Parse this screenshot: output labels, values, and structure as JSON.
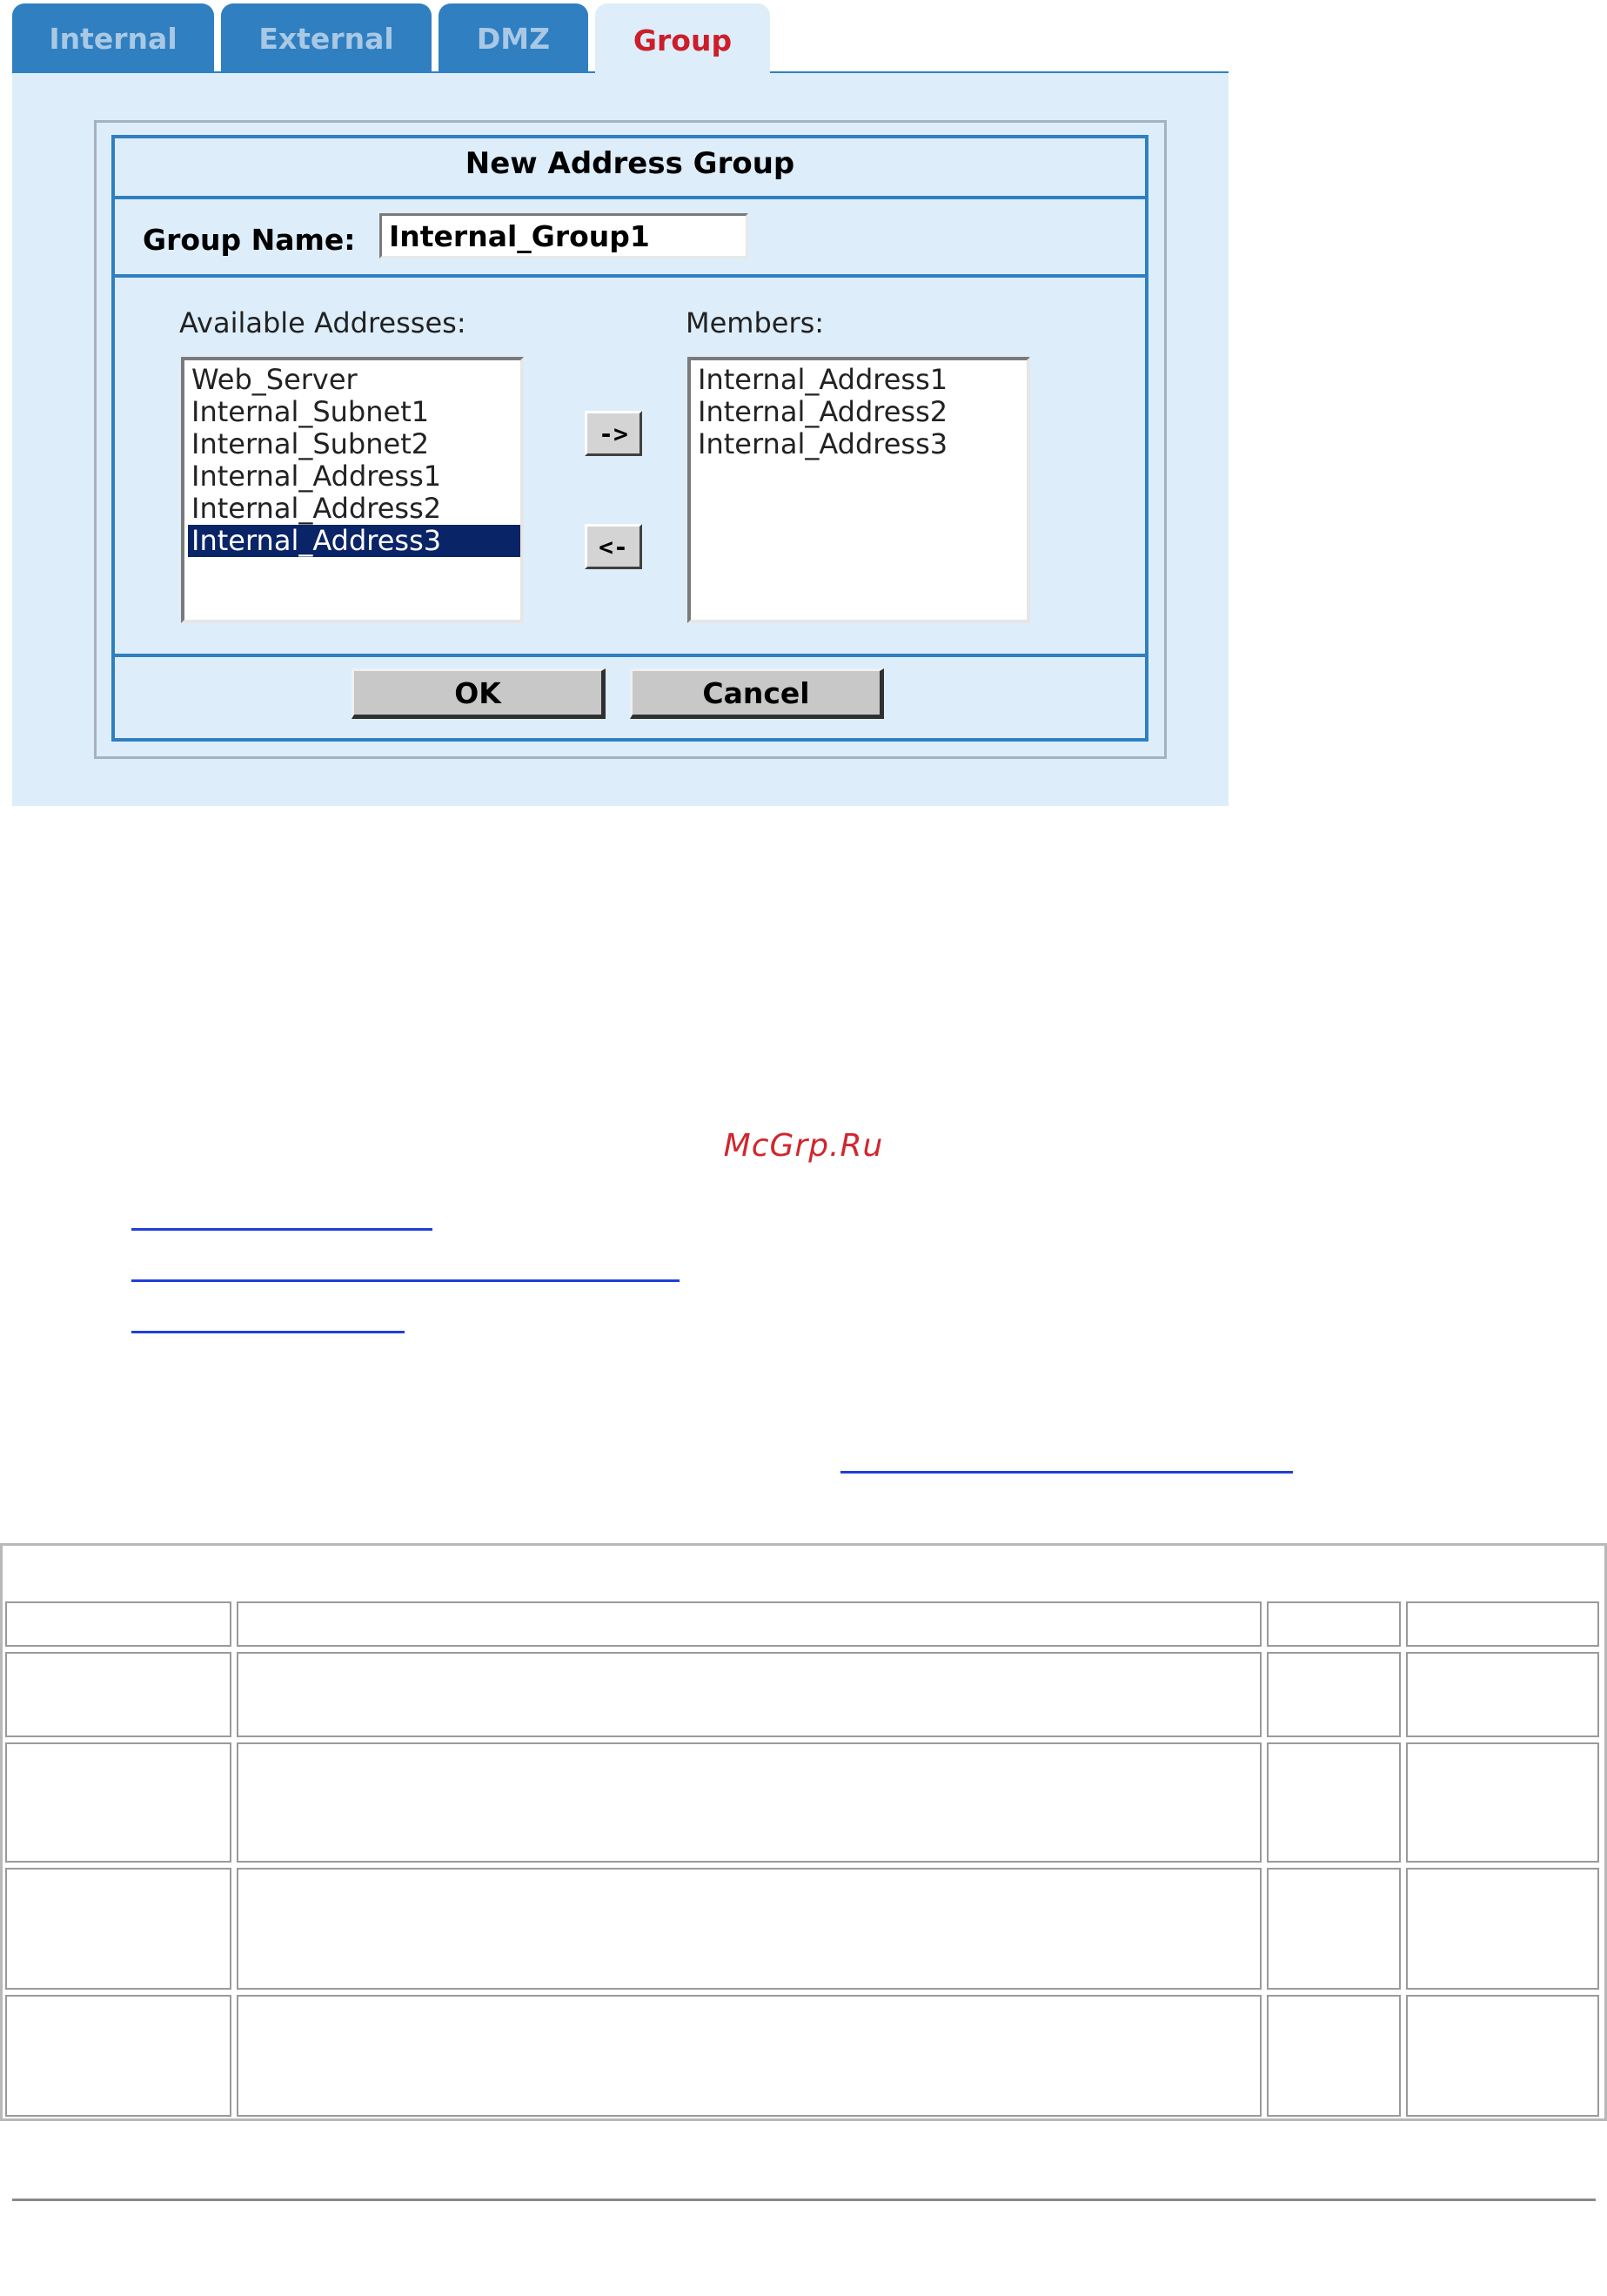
{
  "tabs": [
    {
      "label": "Internal",
      "active": false
    },
    {
      "label": "External",
      "active": false
    },
    {
      "label": "DMZ",
      "active": false
    },
    {
      "label": "Group",
      "active": true
    }
  ],
  "dialog": {
    "title": "New Address Group",
    "group_name_label": "Group Name:",
    "group_name_value": "Internal_Group1",
    "available_label": "Available Addresses:",
    "members_label": "Members:",
    "available_addresses": [
      "Web_Server",
      "Internal_Subnet1",
      "Internal_Subnet2",
      "Internal_Address1",
      "Internal_Address2",
      "Internal_Address3"
    ],
    "selected_available": "Internal_Address3",
    "members": [
      "Internal_Address1",
      "Internal_Address2",
      "Internal_Address3"
    ],
    "add_button": "->",
    "remove_button": "<-",
    "ok_button": "OK",
    "cancel_button": "Cancel"
  },
  "watermark": "McGrp.Ru",
  "colors": {
    "tab_inactive_bg": "#2f7fc1",
    "tab_active_text": "#cc1e2a",
    "panel_bg": "#ddeefa",
    "selection_bg": "#0a2468",
    "link": "#1f3fd9"
  }
}
